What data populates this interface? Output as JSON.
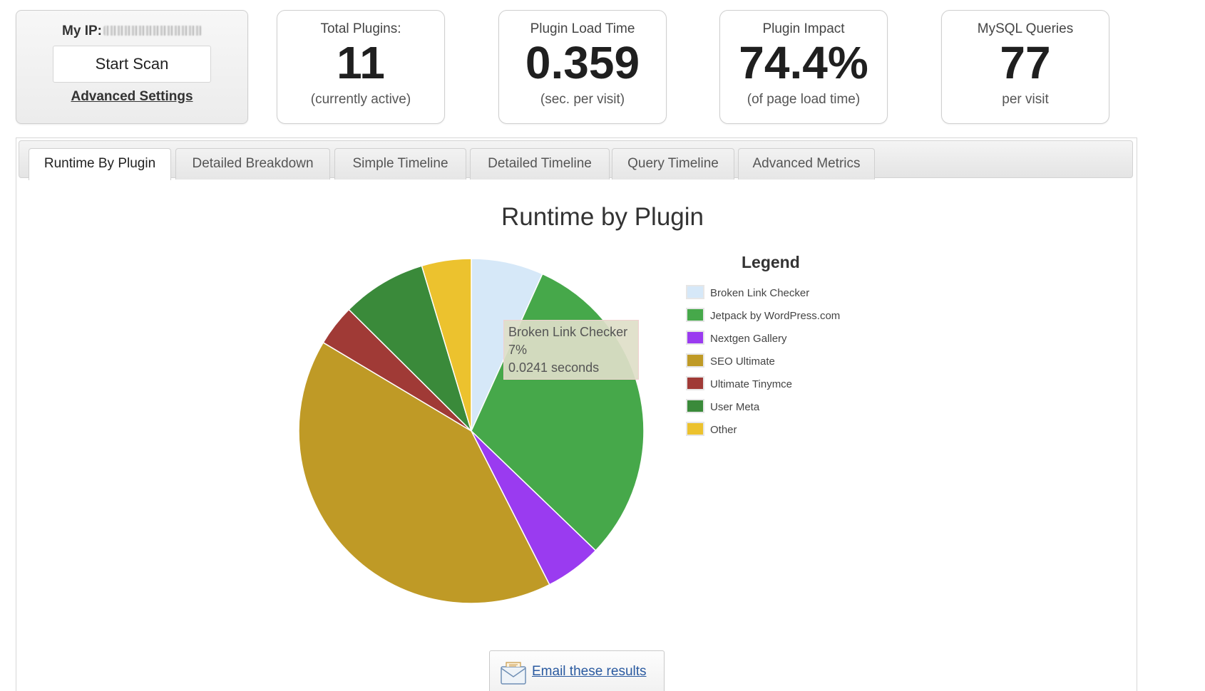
{
  "scan": {
    "ip_label": "My IP:",
    "start_scan": "Start Scan",
    "advanced_settings": "Advanced Settings"
  },
  "stats": [
    {
      "label": "Total Plugins:",
      "value": "11",
      "sub": "(currently active)"
    },
    {
      "label": "Plugin Load Time",
      "value": "0.359",
      "sub": "(sec. per visit)"
    },
    {
      "label": "Plugin Impact",
      "value": "74.4%",
      "sub": "(of page load time)"
    },
    {
      "label": "MySQL Queries",
      "value": "77",
      "sub": "per visit"
    }
  ],
  "tabs": [
    {
      "label": "Runtime By Plugin",
      "active": true
    },
    {
      "label": "Detailed Breakdown",
      "active": false
    },
    {
      "label": "Simple Timeline",
      "active": false
    },
    {
      "label": "Detailed Timeline",
      "active": false
    },
    {
      "label": "Query Timeline",
      "active": false
    },
    {
      "label": "Advanced Metrics",
      "active": false
    }
  ],
  "chart_data": {
    "type": "pie",
    "title": "Runtime by Plugin",
    "legend_title": "Legend",
    "legend_position": "right",
    "categories": [
      "Broken Link Checker",
      "Jetpack by WordPress.com",
      "Nextgen Gallery",
      "SEO Ultimate",
      "Ultimate Tinymce",
      "User Meta",
      "Other"
    ],
    "values": [
      7,
      31.5,
      5.5,
      42.5,
      4,
      8.2,
      4.8
    ],
    "colors": [
      "#d6e8f8",
      "#46a84a",
      "#9a3bf0",
      "#bf9a26",
      "#a03a36",
      "#3a8a3a",
      "#ecc22e"
    ],
    "tooltip": {
      "line1": "Broken Link Checker",
      "line2": "7%",
      "line3": "0.0241 seconds"
    }
  },
  "email": {
    "label": "Email these results",
    "icon": "envelope-icon"
  }
}
